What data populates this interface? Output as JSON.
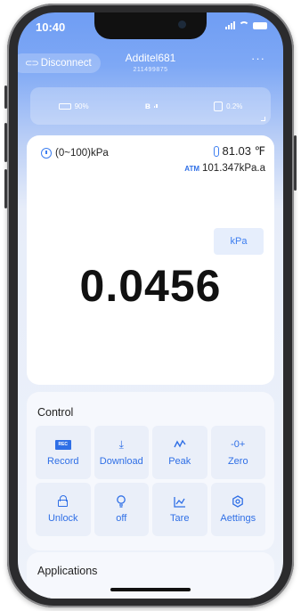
{
  "status_bar": {
    "time": "10:40"
  },
  "header": {
    "disconnect_label": "Disconnect",
    "disconnect_icon": "link-off-icon",
    "device_name": "Additel681",
    "serial_number": "211499875",
    "more_icon": "more-icon"
  },
  "info_strip": {
    "battery": "90%",
    "bluetooth_icon": "bluetooth-icon",
    "storage": "0.2%"
  },
  "measurement": {
    "range": "(0~100)kPa",
    "temperature": "81.03 ℉",
    "atm_label": "ATM",
    "atm_value": "101.347kPa.a",
    "unit": "kPa",
    "reading": "0.0456"
  },
  "control": {
    "title": "Control",
    "items": [
      {
        "label": "Record",
        "icon": "record-icon",
        "icon_text": "REC"
      },
      {
        "label": "Download",
        "icon": "download-icon"
      },
      {
        "label": "Peak",
        "icon": "peak-icon"
      },
      {
        "label": "Zero",
        "icon": "zero-icon"
      },
      {
        "label": "Unlock",
        "icon": "unlock-icon"
      },
      {
        "label": "off",
        "icon": "bulb-icon"
      },
      {
        "label": "Tare",
        "icon": "tare-icon"
      },
      {
        "label": "Aettings",
        "icon": "settings-icon"
      }
    ]
  },
  "applications": {
    "title": "Applications"
  },
  "colors": {
    "accent": "#2f6fe6",
    "header_top": "#6f9df4",
    "page_bg": "#eef2fa"
  }
}
